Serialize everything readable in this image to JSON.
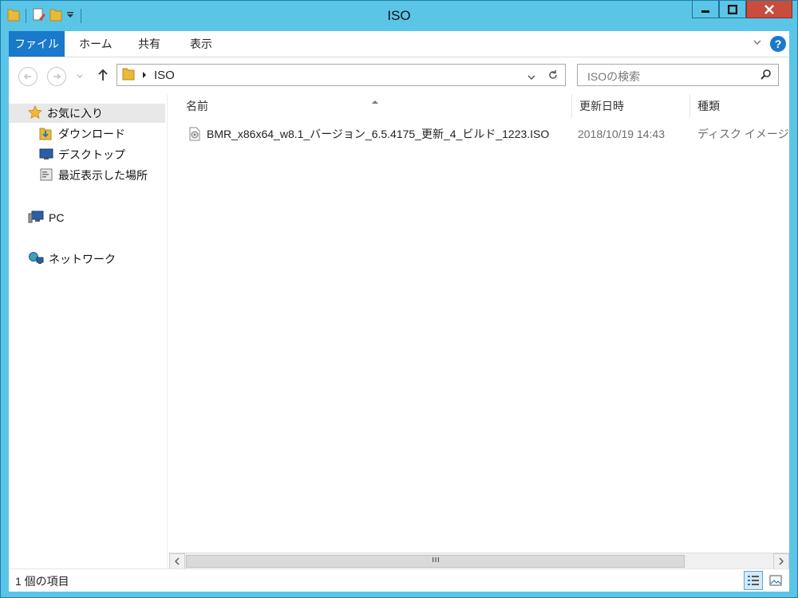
{
  "window": {
    "title": "ISO"
  },
  "ribbon": {
    "tabs": [
      {
        "label": "ファイル",
        "active": true
      },
      {
        "label": "ホーム"
      },
      {
        "label": "共有"
      },
      {
        "label": "表示"
      }
    ],
    "help_label": "?"
  },
  "navbar": {
    "path": [
      "ISO"
    ],
    "search_placeholder": "ISOの検索"
  },
  "nav_pane": {
    "favorites_label": "お気に入り",
    "favorites": [
      "ダウンロード",
      "デスクトップ",
      "最近表示した場所"
    ],
    "pc_label": "PC",
    "network_label": "ネットワーク"
  },
  "file_list": {
    "columns": [
      "名前",
      "更新日時",
      "種類"
    ],
    "rows": [
      {
        "name": "BMR_x86x64_w8.1_バージョン_6.5.4175_更新_4_ビルド_1223.ISO",
        "modified": "2018/10/19 14:43",
        "type": "ディスク イメージ ファ"
      }
    ]
  },
  "status": {
    "item_count": "1 個の項目"
  },
  "colors": {
    "frame": "#5bc5e8",
    "accent": "#1979ca",
    "close": "#c94c3c"
  }
}
